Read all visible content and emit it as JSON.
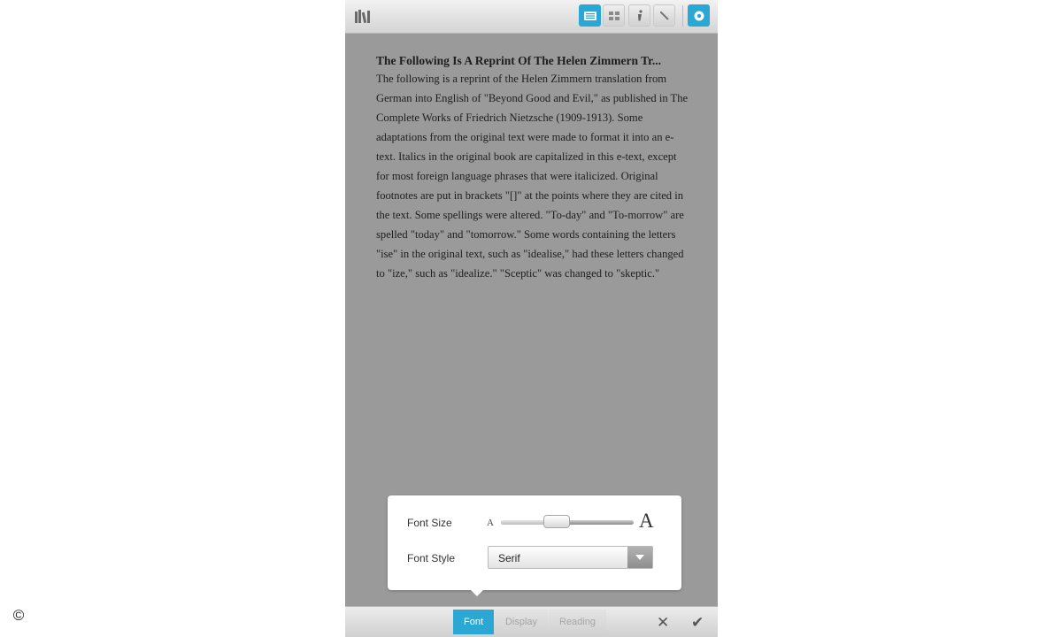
{
  "book": {
    "title": "The Following Is A Reprint Of The Helen Zimmern Tr...",
    "body": "The following is a reprint of the Helen Zimmern translation from German into English of \"Beyond Good and Evil,\" as published in The Complete Works of Friedrich Nietzsche (1909-1913). Some adaptations from the original text were made to format it into an e-text. Italics in the original book are capitalized in this e-text, except for most foreign language phrases that were italicized. Original footnotes are put in brackets \"[]\" at the points where they are cited in the text. Some spellings were altered. \"To-day\" and \"To-morrow\" are spelled \"today\" and \"tomorrow.\" Some words containing the letters \"ise\" in the original text, such as \"idealise,\" had these letters changed to \"ize,\" such as \"idealize.\" \"Sceptic\" was changed to \"skeptic.\""
  },
  "toolbar": {
    "icons": [
      "library-icon",
      "text-view-icon",
      "grid-view-icon",
      "info-icon",
      "edit-icon",
      "settings-icon"
    ]
  },
  "font_settings": {
    "size_label": "Font Size",
    "size_small_glyph": "A",
    "size_large_glyph": "A",
    "size_level": 0.4,
    "style_label": "Font Style",
    "style_value": "Serif"
  },
  "bottom_bar": {
    "tabs": [
      {
        "label": "Font",
        "active": true
      },
      {
        "label": "Display",
        "active": false
      },
      {
        "label": "Reading",
        "active": false
      }
    ],
    "close_symbol": "✕",
    "confirm_symbol": "✔"
  },
  "watermark": "©",
  "colors": {
    "accent": "#2aa7d3",
    "page_background": "#9a9a9a"
  }
}
